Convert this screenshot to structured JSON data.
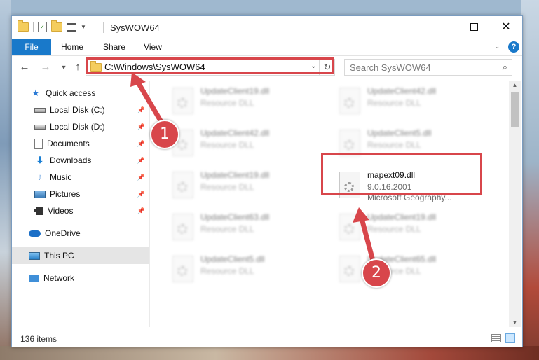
{
  "window": {
    "title": "SysWOW64"
  },
  "ribbon": {
    "tabs": [
      "File",
      "Home",
      "Share",
      "View"
    ],
    "help": "?"
  },
  "address": {
    "path": "C:\\Windows\\SysWOW64",
    "search_placeholder": "Search SysWOW64"
  },
  "sidebar": {
    "items": [
      {
        "label": "Quick access",
        "icon": "star-icon"
      },
      {
        "label": "Local Disk (C:)",
        "icon": "disk-icon",
        "pinned": true
      },
      {
        "label": "Local Disk (D:)",
        "icon": "disk-icon",
        "pinned": true
      },
      {
        "label": "Documents",
        "icon": "documents-icon",
        "pinned": true
      },
      {
        "label": "Downloads",
        "icon": "download-icon",
        "pinned": true
      },
      {
        "label": "Music",
        "icon": "music-icon",
        "pinned": true
      },
      {
        "label": "Pictures",
        "icon": "pictures-icon",
        "pinned": true
      },
      {
        "label": "Videos",
        "icon": "videos-icon",
        "pinned": true
      },
      {
        "label": "OneDrive",
        "icon": "cloud-icon"
      },
      {
        "label": "This PC",
        "icon": "computer-icon",
        "selected": true
      },
      {
        "label": "Network",
        "icon": "network-icon"
      }
    ]
  },
  "files": [
    {
      "name": "UpdateClient19.dll",
      "type": "Resource DLL"
    },
    {
      "name": "UpdateClient42.dll",
      "type": "Resource DLL"
    },
    {
      "name": "UpdateClient42.dll",
      "type": "Resource DLL"
    },
    {
      "name": "UpdateClient5.dll",
      "type": "Resource DLL"
    },
    {
      "name": "UpdateClient19.dll",
      "type": "Resource DLL"
    },
    {
      "name": "mapext09.dll",
      "version": "9.0.16.2001",
      "description": "Microsoft Geography...",
      "highlighted": true
    },
    {
      "name": "UpdateClient63.dll",
      "type": "Resource DLL"
    },
    {
      "name": "UpdateClient19.dll",
      "type": "Resource DLL"
    },
    {
      "name": "UpdateClient5.dll",
      "type": "Resource DLL"
    },
    {
      "name": "UpdateClient65.dll",
      "type": "Resource DLL"
    }
  ],
  "status": {
    "item_count": "136 items"
  },
  "annotations": {
    "step1": "1",
    "step2": "2",
    "color": "#d8464b"
  }
}
